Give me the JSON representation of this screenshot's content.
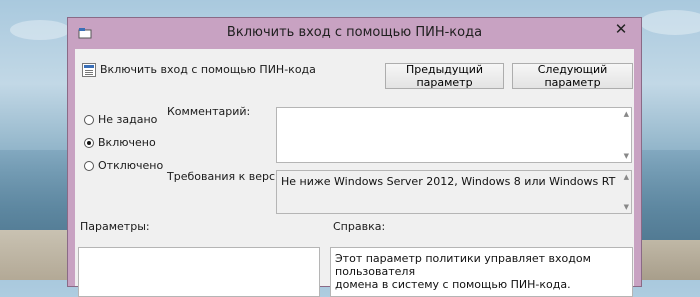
{
  "window": {
    "title": "Включить вход с помощью ПИН-кода",
    "close_glyph": "✕"
  },
  "header": {
    "policy_name": "Включить вход с помощью ПИН-кода",
    "prev_button": "Предыдущий параметр",
    "next_button": "Следующий параметр"
  },
  "state_options": [
    {
      "label": "Не задано",
      "checked": false
    },
    {
      "label": "Включено",
      "checked": true
    },
    {
      "label": "Отключено",
      "checked": false
    }
  ],
  "comment": {
    "label": "Комментарий:",
    "value": ""
  },
  "requirements": {
    "label": "Требования к версии:",
    "value": "Не ниже Windows Server 2012, Windows 8 или Windows RT"
  },
  "options_section": {
    "label": "Параметры:"
  },
  "help_section": {
    "label": "Справка:",
    "text_line1": "Этот параметр политики управляет входом пользователя",
    "text_line2": "домена в систему с помощью ПИН-кода."
  },
  "colors": {
    "title_bar": "#c8a2c2",
    "client_bg": "#f0f0f0"
  }
}
